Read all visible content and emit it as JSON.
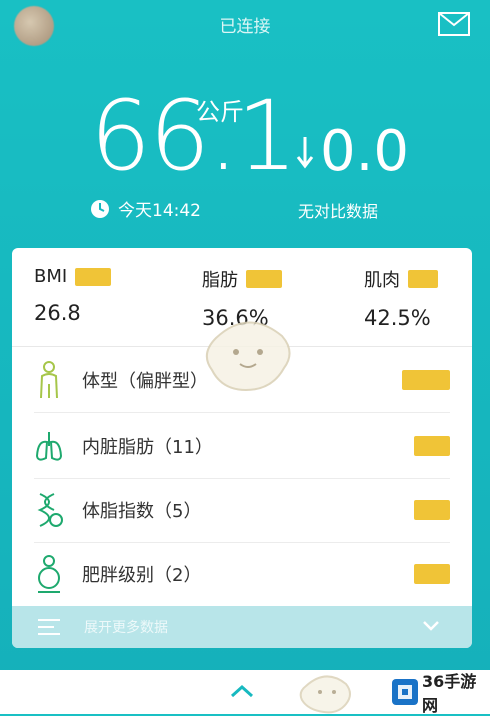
{
  "header": {
    "status": "已连接",
    "mail_icon": "mail-icon"
  },
  "weight": {
    "value": "66.1",
    "unit": "公斤",
    "time": "今天14:42",
    "delta": "0.0",
    "delta_label": "无对比数据"
  },
  "metrics": [
    {
      "label": "BMI",
      "value": "26.8"
    },
    {
      "label": "脂肪",
      "value": "36.6%"
    },
    {
      "label": "肌肉",
      "value": "42.5%"
    }
  ],
  "rows": [
    {
      "label": "体型（偏胖型）",
      "icon": "body-shape-icon"
    },
    {
      "label": "内脏脂肪（11）",
      "icon": "lungs-icon"
    },
    {
      "label": "体脂指数（5）",
      "icon": "dna-icon"
    },
    {
      "label": "肥胖级别（2）",
      "icon": "obesity-icon"
    }
  ],
  "more": {
    "label": "展开更多数据"
  },
  "watermark": {
    "text": "36手游网"
  },
  "colors": {
    "accent": "#17b9c0",
    "badge": "#f0c437"
  }
}
